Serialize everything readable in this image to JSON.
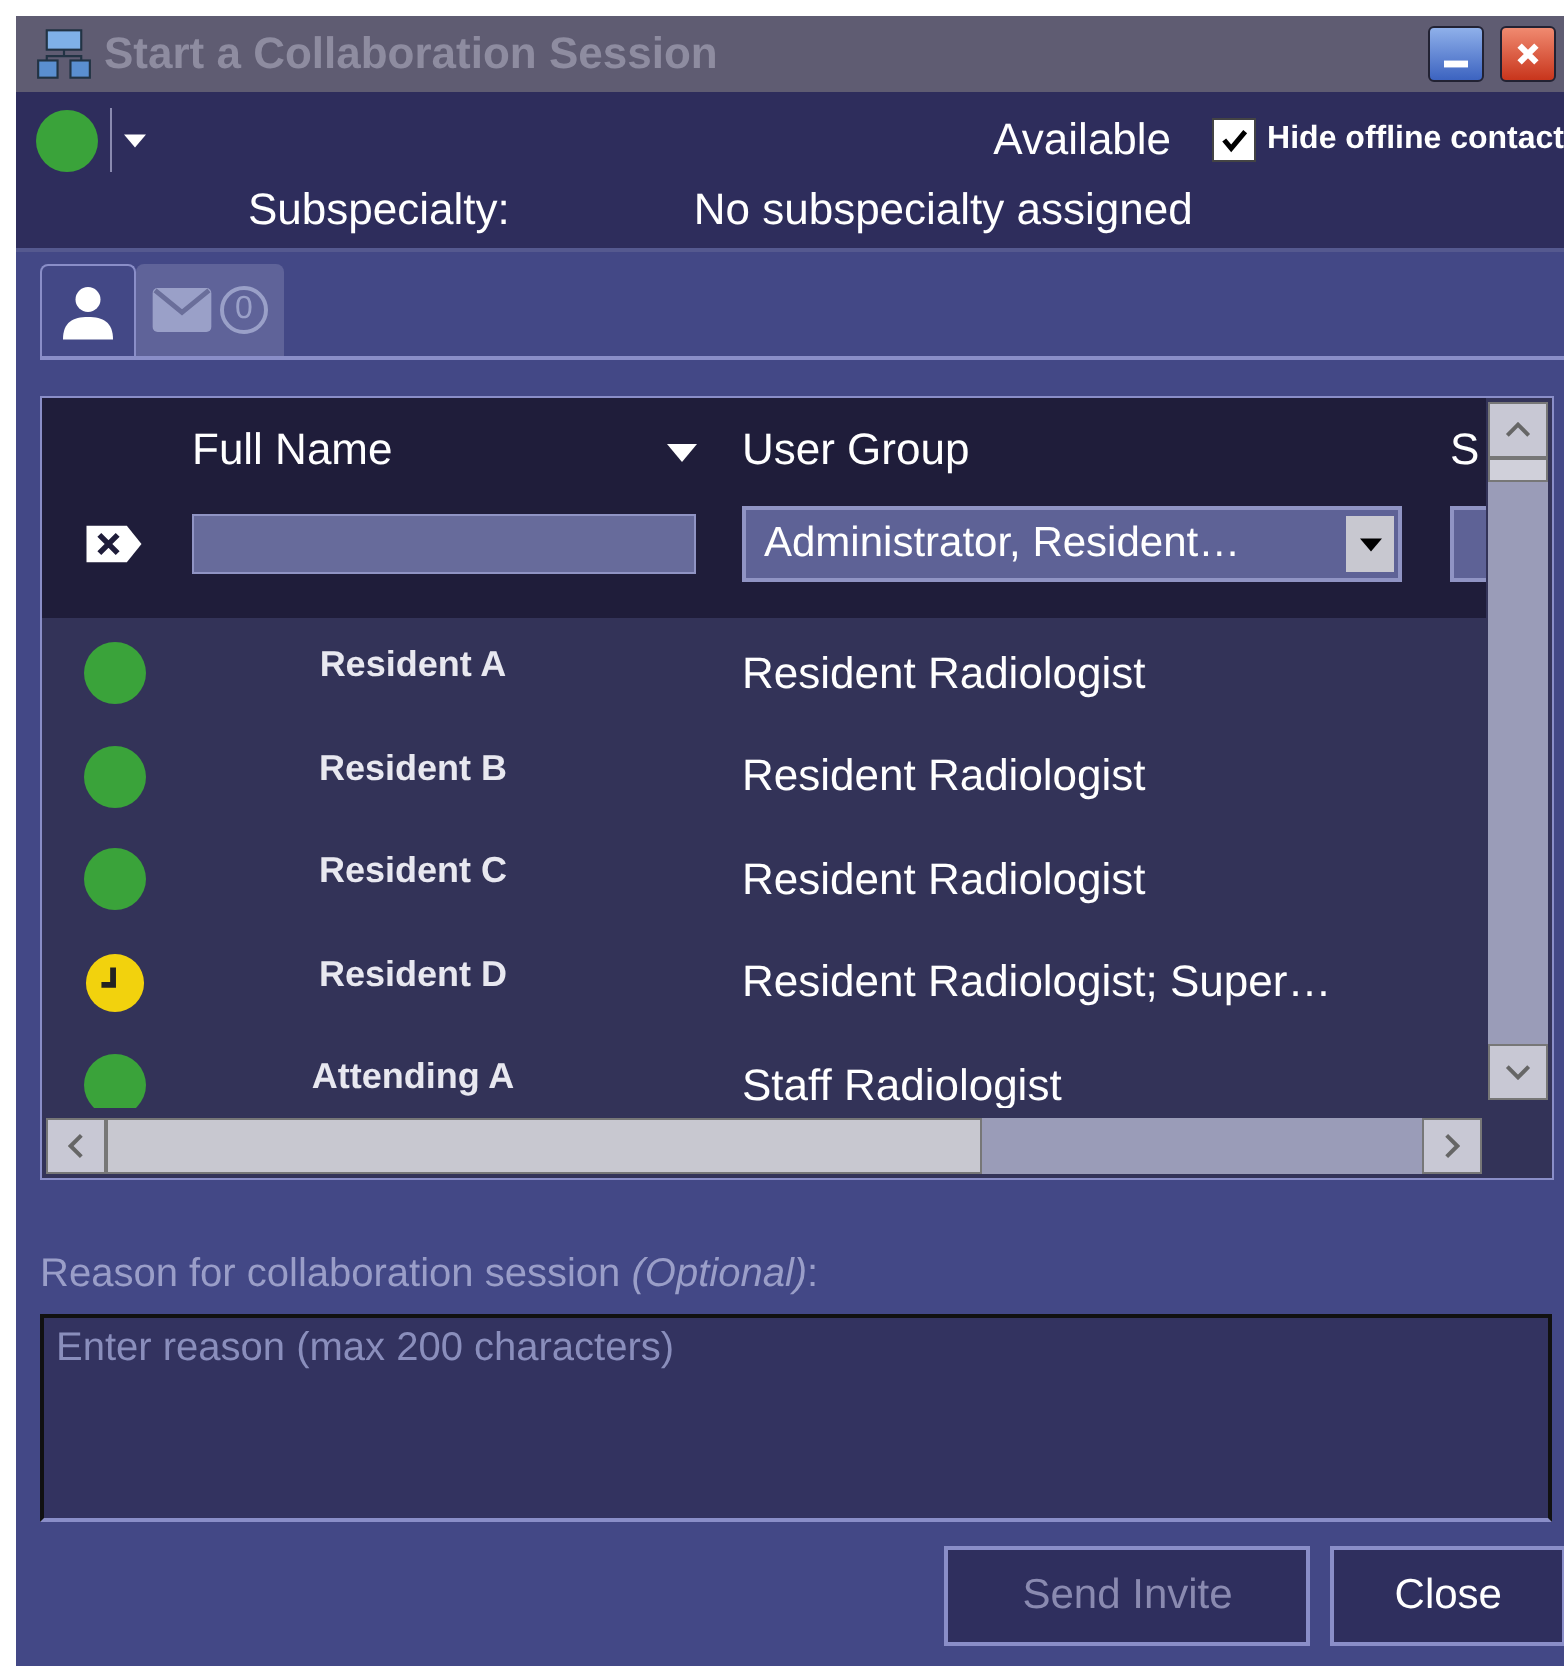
{
  "window": {
    "title": "Start a Collaboration Session"
  },
  "presence": {
    "color": "#3aa33a",
    "label": "Available"
  },
  "hide_offline": {
    "label": "Hide offline contact",
    "checked": true
  },
  "subspecialty": {
    "label": "Subspecialty:",
    "value": "No subspecialty assigned"
  },
  "tabs": [
    {
      "kind": "contacts",
      "selected": true
    },
    {
      "kind": "messages",
      "count": "0",
      "selected": false
    }
  ],
  "table": {
    "columns": [
      "Full Name",
      "User Group",
      "S"
    ],
    "filters": {
      "user_group": "Administrator, Resident…"
    },
    "rows": [
      {
        "color": "#3aa33a",
        "name": "Resident A",
        "group": "Resident Radiologist"
      },
      {
        "color": "#3aa33a",
        "name": "Resident B",
        "group": "Resident Radiologist"
      },
      {
        "color": "#3aa33a",
        "name": "Resident C",
        "group": "Resident Radiologist"
      },
      {
        "color": "#f2d20d",
        "name": "Resident D",
        "group": "Resident Radiologist; Super…"
      },
      {
        "color": "#3aa33a",
        "name": "Attending A",
        "group": "Staff Radiologist"
      }
    ]
  },
  "reason": {
    "label": "Reason for collaboration session *(Optional)*:",
    "placeholder": "Enter reason (max 200 characters)"
  },
  "buttons": [
    {
      "label": "Send Invite",
      "disabled": true
    },
    {
      "label": "Close",
      "disabled": false
    }
  ]
}
